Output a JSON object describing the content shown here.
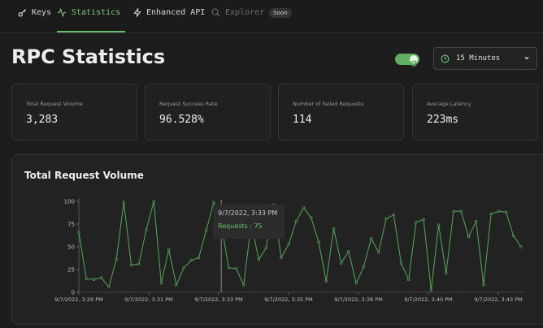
{
  "nav": {
    "tabs": [
      {
        "label": "Keys",
        "icon": "key-icon"
      },
      {
        "label": "Statistics",
        "icon": "activity-icon"
      },
      {
        "label": "Enhanced API",
        "icon": "lightning-icon"
      },
      {
        "label": "Explorer",
        "icon": "search-icon",
        "badge": "Soon"
      }
    ]
  },
  "page": {
    "title": "RPC Statistics",
    "refresh_toggle": true,
    "time_range": "15 Minutes"
  },
  "stats": [
    {
      "label": "Total Request Volume",
      "value": "3,283"
    },
    {
      "label": "Request Success Rate",
      "value": "96.528%"
    },
    {
      "label": "Number of Failed Requests",
      "value": "114"
    },
    {
      "label": "Average Latency",
      "value": "223ms"
    }
  ],
  "tooltip": {
    "date": "9/7/2022, 3:33 PM",
    "requests": "Requests : 75"
  },
  "colors": {
    "accent": "#6abf6e",
    "line": "#57a85b"
  },
  "chart_data": {
    "type": "line",
    "title": "Total Request Volume",
    "ylim": [
      0,
      100
    ],
    "yticks": [
      0,
      25,
      50,
      75,
      100
    ],
    "xtick_labels": [
      "9/7/2022, 3:29 PM",
      "9/7/2022, 3:31 PM",
      "9/7/2022, 3:33 PM",
      "9/7/2022, 3:35 PM",
      "9/7/2022, 3:38 PM",
      "9/7/2022, 3:40 PM",
      "9/7/2022, 3:43 PM"
    ],
    "series": [
      {
        "values": [
          66,
          15,
          14,
          16,
          6,
          36,
          99,
          30,
          31,
          69,
          100,
          10,
          47,
          8,
          27,
          35,
          38,
          68,
          99,
          75,
          27,
          26,
          8,
          76,
          36,
          49,
          96,
          38,
          53,
          78,
          93,
          82,
          55,
          12,
          70,
          32,
          45,
          10,
          28,
          59,
          44,
          81,
          85,
          32,
          14,
          77,
          80,
          2,
          74,
          21,
          89,
          89,
          61,
          78,
          8,
          86,
          89,
          88,
          62,
          50
        ]
      }
    ]
  }
}
